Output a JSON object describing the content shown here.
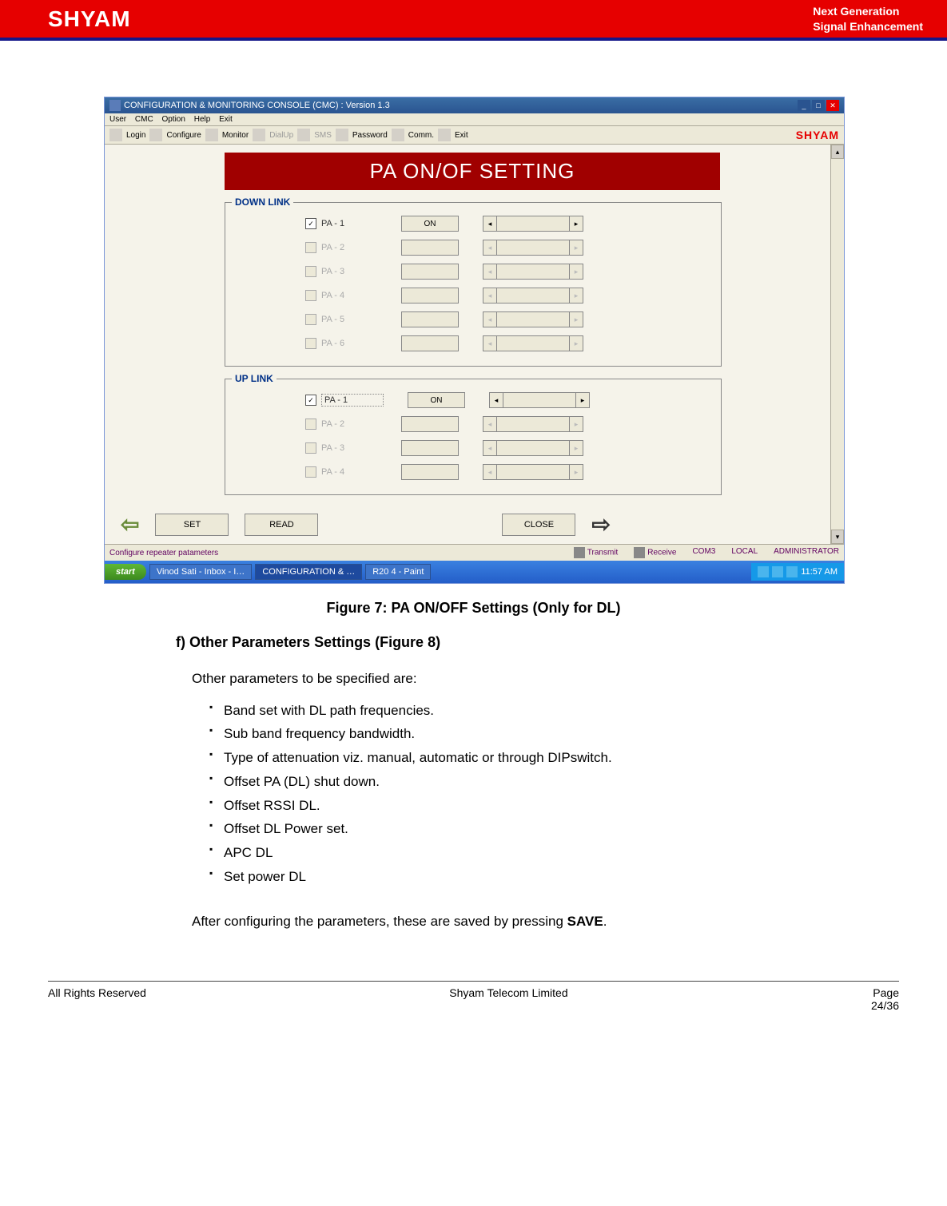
{
  "header": {
    "logo": "SHYAM",
    "tag1": "Next Generation",
    "tag2": "Signal Enhancement"
  },
  "win": {
    "title": "CONFIGURATION & MONITORING CONSOLE (CMC)  :  Version 1.3"
  },
  "menu": [
    "User",
    "CMC",
    "Option",
    "Help",
    "Exit"
  ],
  "tool": {
    "login": "Login",
    "configure": "Configure",
    "monitor": "Monitor",
    "dialup": "DialUp",
    "sms": "SMS",
    "password": "Password",
    "comm": "Comm.",
    "exit": "Exit",
    "brand": "SHYAM"
  },
  "panel": {
    "title": "PA ON/OF SETTING",
    "down": "DOWN LINK",
    "up": "UP LINK"
  },
  "dl": [
    {
      "l": "PA - 1",
      "c": true,
      "s": "ON",
      "e": true
    },
    {
      "l": "PA - 2",
      "c": false,
      "s": "",
      "e": false
    },
    {
      "l": "PA - 3",
      "c": false,
      "s": "",
      "e": false
    },
    {
      "l": "PA - 4",
      "c": false,
      "s": "",
      "e": false
    },
    {
      "l": "PA - 5",
      "c": false,
      "s": "",
      "e": false
    },
    {
      "l": "PA - 6",
      "c": false,
      "s": "",
      "e": false
    }
  ],
  "ul": [
    {
      "l": "PA - 1",
      "c": true,
      "s": "ON",
      "e": true,
      "d": true
    },
    {
      "l": "PA - 2",
      "c": false,
      "s": "",
      "e": false
    },
    {
      "l": "PA - 3",
      "c": false,
      "s": "",
      "e": false
    },
    {
      "l": "PA - 4",
      "c": false,
      "s": "",
      "e": false
    }
  ],
  "btns": {
    "set": "SET",
    "read": "READ",
    "close": "CLOSE"
  },
  "status": {
    "msg": "Configure repeater patameters",
    "tx": "Transmit",
    "rx": "Receive",
    "com": "COM3",
    "loc": "LOCAL",
    "admin": "ADMINISTRATOR"
  },
  "task": {
    "start": "start",
    "i1": "Vinod Sati - Inbox - I…",
    "i2": "CONFIGURATION & …",
    "i3": "R20 4 - Paint",
    "time": "11:57 AM"
  },
  "doc": {
    "fig": "Figure 7: PA ON/OFF Settings (Only for DL)",
    "sec": "f) Other Parameters Settings (Figure 8)",
    "intro": "Other parameters to be specified are:",
    "items": [
      "Band set with DL path frequencies.",
      "Sub band frequency bandwidth.",
      "Type of attenuation viz. manual, automatic or through DIPswitch.",
      "Offset PA (DL) shut down.",
      "Offset RSSI DL.",
      "Offset DL Power set.",
      "APC DL",
      "Set power DL"
    ],
    "after1": "After configuring the parameters, these are saved by pressing ",
    "after2": "SAVE",
    "after3": "."
  },
  "foot": {
    "l": "All Rights Reserved",
    "c": "Shyam Telecom Limited",
    "p": "Page",
    "n": "24/36"
  }
}
